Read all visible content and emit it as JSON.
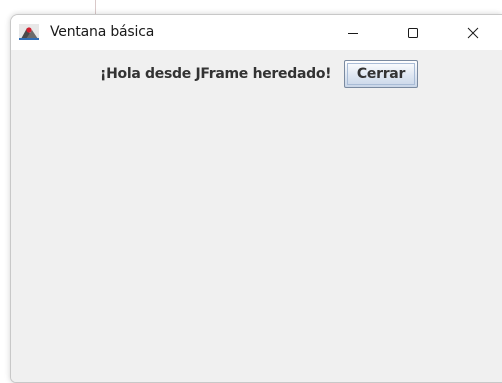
{
  "window": {
    "title": "Ventana básica",
    "app_icon": "java-duke-icon",
    "caption_buttons": {
      "minimize_icon": "minimize-icon",
      "maximize_icon": "maximize-icon",
      "close_icon": "close-icon"
    }
  },
  "content": {
    "greeting": "¡Hola desde JFrame heredado!",
    "close_button_label": "Cerrar"
  },
  "colors": {
    "window_background": "#f0f0f0",
    "titlebar_background": "#ffffff",
    "text": "#333333",
    "button_border": "#7a8aa0",
    "button_gradient_end": "#c9d6e8"
  }
}
